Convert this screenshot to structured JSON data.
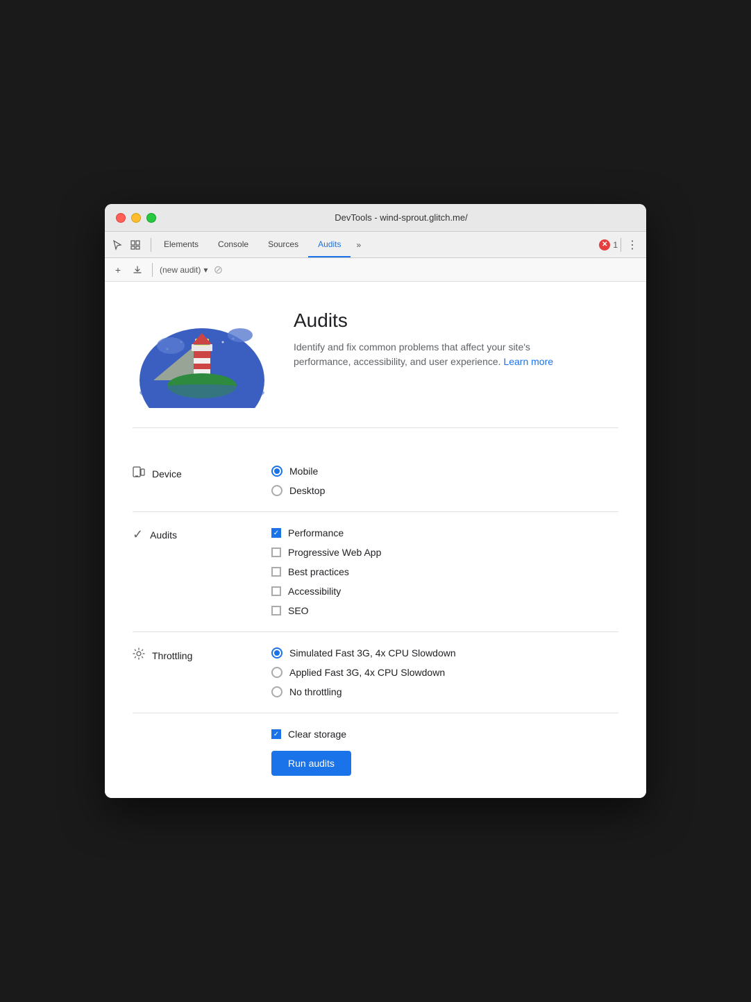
{
  "window": {
    "title": "DevTools - wind-sprout.glitch.me/"
  },
  "traffic_lights": {
    "close": "close",
    "minimize": "minimize",
    "maximize": "maximize"
  },
  "toolbar": {
    "tabs": [
      {
        "id": "elements",
        "label": "Elements",
        "active": false
      },
      {
        "id": "console",
        "label": "Console",
        "active": false
      },
      {
        "id": "sources",
        "label": "Sources",
        "active": false
      },
      {
        "id": "audits",
        "label": "Audits",
        "active": true
      }
    ],
    "more_label": "»",
    "error_count": "1",
    "new_audit_label": "(new audit)"
  },
  "hero": {
    "title": "Audits",
    "description": "Identify and fix common problems that affect your site's performance, accessibility, and user experience.",
    "learn_more": "Learn more"
  },
  "device": {
    "label": "Device",
    "options": [
      {
        "id": "mobile",
        "label": "Mobile",
        "checked": true
      },
      {
        "id": "desktop",
        "label": "Desktop",
        "checked": false
      }
    ]
  },
  "audits": {
    "label": "Audits",
    "options": [
      {
        "id": "performance",
        "label": "Performance",
        "checked": true
      },
      {
        "id": "pwa",
        "label": "Progressive Web App",
        "checked": false
      },
      {
        "id": "best-practices",
        "label": "Best practices",
        "checked": false
      },
      {
        "id": "accessibility",
        "label": "Accessibility",
        "checked": false
      },
      {
        "id": "seo",
        "label": "SEO",
        "checked": false
      }
    ]
  },
  "throttling": {
    "label": "Throttling",
    "options": [
      {
        "id": "simulated-fast-3g",
        "label": "Simulated Fast 3G, 4x CPU Slowdown",
        "checked": true
      },
      {
        "id": "applied-fast-3g",
        "label": "Applied Fast 3G, 4x CPU Slowdown",
        "checked": false
      },
      {
        "id": "no-throttling",
        "label": "No throttling",
        "checked": false
      }
    ]
  },
  "storage": {
    "options": [
      {
        "id": "clear-storage",
        "label": "Clear storage",
        "checked": true
      }
    ]
  },
  "run_button": {
    "label": "Run audits"
  }
}
